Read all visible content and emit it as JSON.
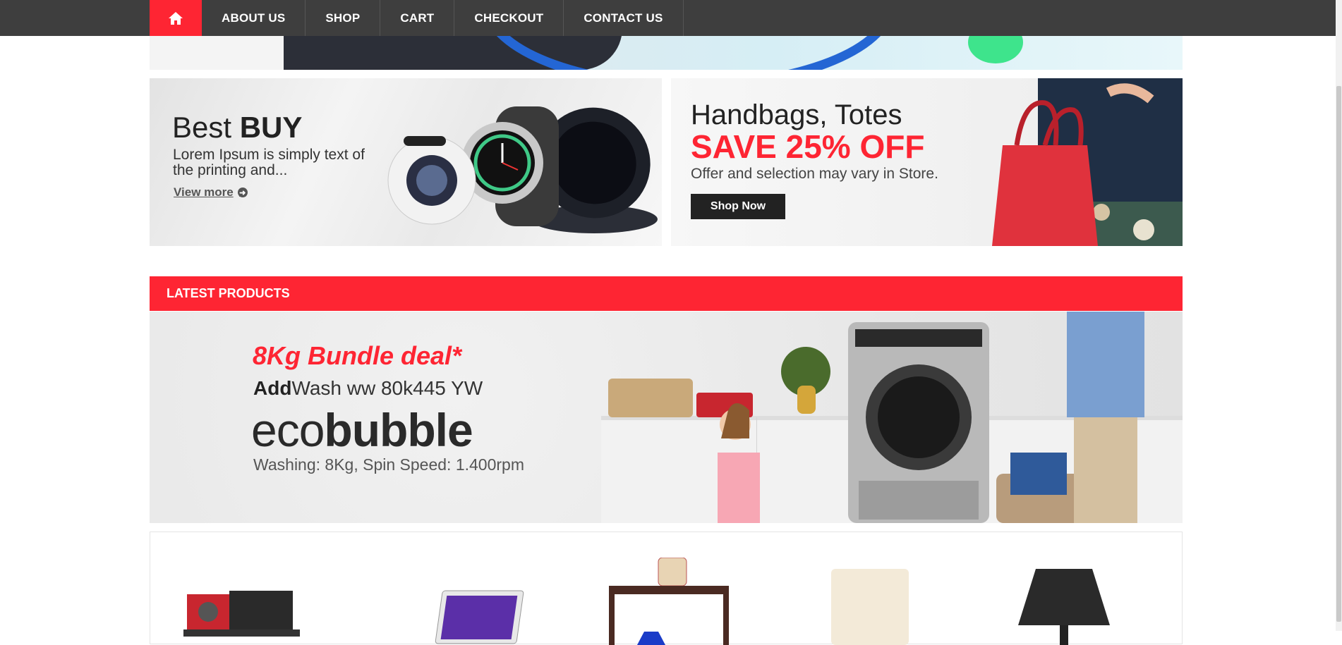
{
  "nav": {
    "home_icon": "home-icon",
    "items": [
      {
        "label": "ABOUT US"
      },
      {
        "label": "SHOP"
      },
      {
        "label": "CART"
      },
      {
        "label": "CHECKOUT"
      },
      {
        "label": "CONTACT US"
      }
    ]
  },
  "promo_left": {
    "title_light": "Best ",
    "title_bold": "BUY",
    "description": "Lorem Ipsum is simply text of the printing and...",
    "link_label": "View more",
    "link_icon": "arrow-circle-right-icon"
  },
  "promo_right": {
    "title": "Handbags, Totes",
    "save": "SAVE 25% OFF",
    "offer": "Offer and selection may vary in Store.",
    "button_label": "Shop Now"
  },
  "latest": {
    "heading": "LATEST PRODUCTS",
    "deal_title": "8Kg Bundle deal*",
    "model_bold": "Add",
    "model_rest": "Wash ww 80k445 YW",
    "eco_light": "eco",
    "eco_bold": "bubble",
    "spec": "Washing: 8Kg, Spin Speed: 1.400rpm"
  },
  "products": [
    {
      "name": "engine-product"
    },
    {
      "name": "tablet-product"
    },
    {
      "name": "side-table-product"
    },
    {
      "name": "floor-lamp-product"
    },
    {
      "name": "table-lamp-product"
    }
  ],
  "colors": {
    "accent": "#fe2533",
    "nav_bg": "#3e3e3e"
  }
}
